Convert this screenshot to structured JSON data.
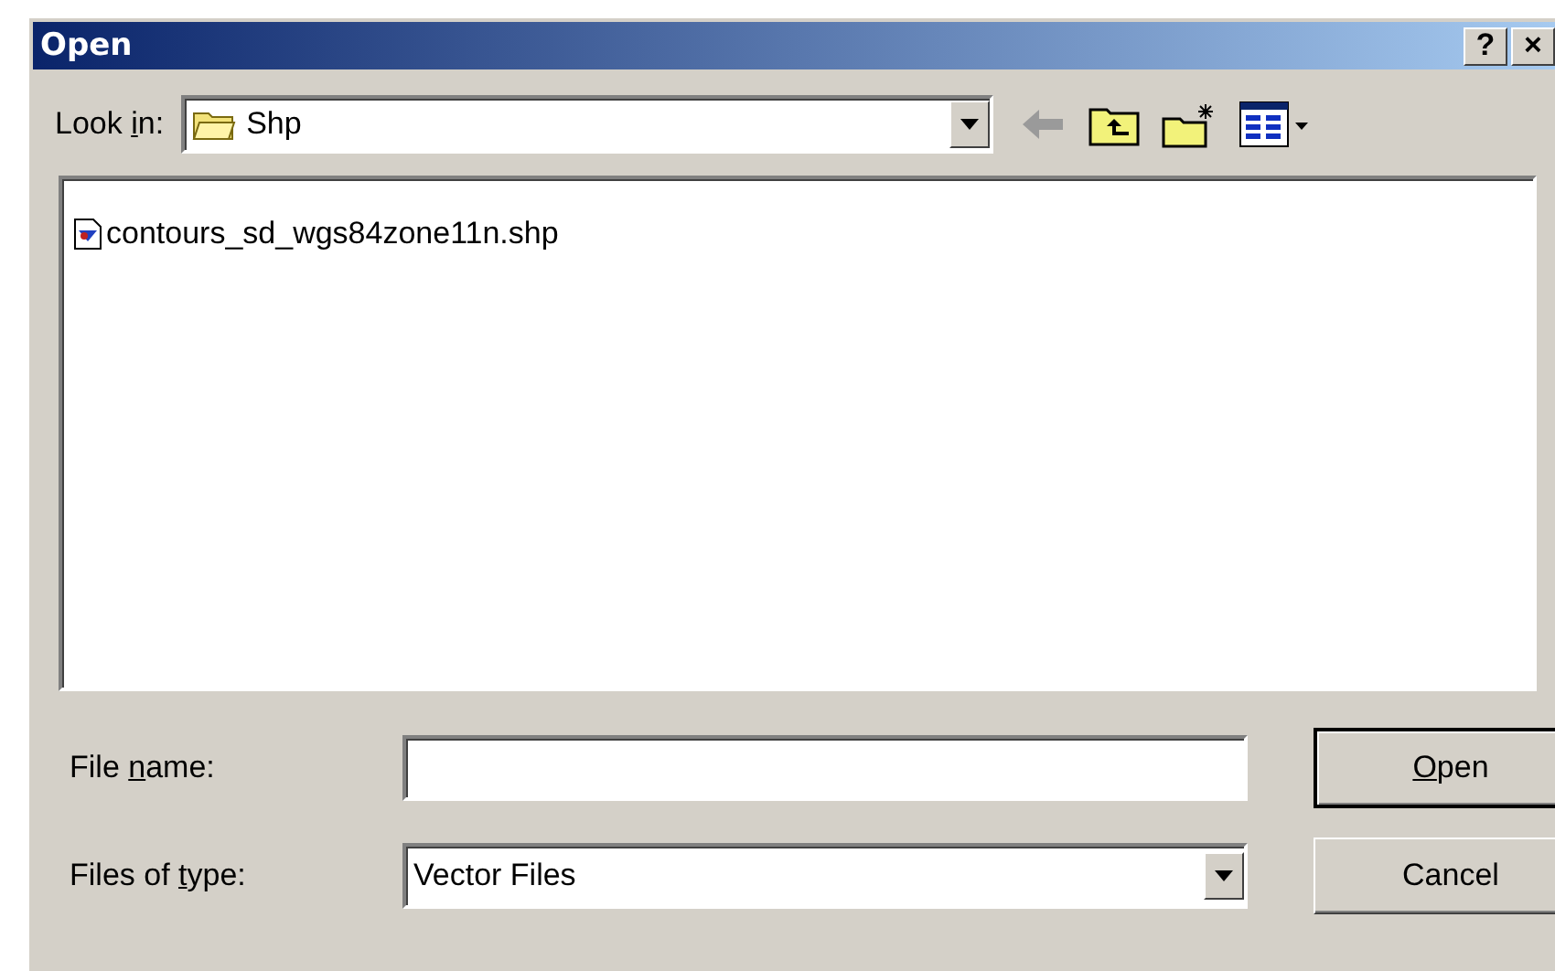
{
  "window": {
    "title": "Open",
    "title_buttons": [
      "?",
      "×"
    ]
  },
  "look_in": {
    "label": {
      "before": "Look ",
      "key": "i",
      "after": "n:"
    },
    "value": "Shp"
  },
  "files": [
    {
      "name": "contours_sd_wgs84zone11n.shp",
      "selected": false
    }
  ],
  "file_name": {
    "label": {
      "before": "File ",
      "key": "n",
      "after": "ame:"
    }
  },
  "file_type": {
    "label": {
      "before": "Files of ",
      "key": "t",
      "after": "ype:"
    },
    "value": "Vector Files"
  },
  "buttons": [
    {
      "label": {
        "key": "O",
        "after": "pen"
      },
      "default": true
    },
    {
      "label": {
        "before": "Cancel"
      },
      "default": false
    }
  ]
}
